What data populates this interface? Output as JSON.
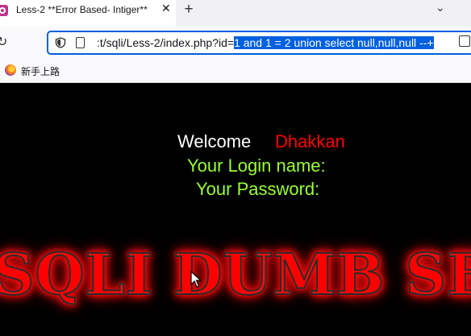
{
  "browser": {
    "tab": {
      "title": "Less-2 **Error Based- Intiger**",
      "close_glyph": "✕",
      "favicon": "sqli-lab-icon"
    },
    "new_tab_glyph": "+",
    "tab_list_glyph": "⌄",
    "reload_glyph": "↻",
    "url_prefix": ":t/sqli/Less-2/index.php?id=",
    "url_selected": "1 and 1 = 2 union select null,null,null --+",
    "accent": "#0060df"
  },
  "bookmarks": [
    {
      "label": "新手上路",
      "icon": "firefox-icon"
    }
  ],
  "page": {
    "welcome": "Welcome",
    "user": "Dhakkan",
    "login_label": "Your Login name:",
    "password_label": "Your Password:",
    "banner": "SQLI DUMB SERIES",
    "colors": {
      "background": "#000000",
      "welcome": "#ffffff",
      "user": "#ff0000",
      "labels": "#99ff33",
      "glow": "#ff0000"
    }
  }
}
